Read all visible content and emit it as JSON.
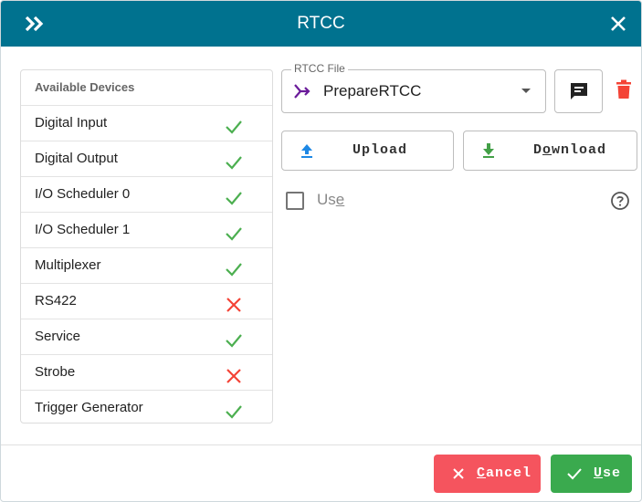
{
  "title": "RTCC",
  "devices": {
    "header": "Available Devices",
    "items": [
      {
        "label": "Digital Input",
        "status": "ok"
      },
      {
        "label": "Digital Output",
        "status": "ok"
      },
      {
        "label": "I/O Scheduler 0",
        "status": "ok"
      },
      {
        "label": "I/O Scheduler 1",
        "status": "ok"
      },
      {
        "label": "Multiplexer",
        "status": "ok"
      },
      {
        "label": "RS422",
        "status": "error"
      },
      {
        "label": "Service",
        "status": "ok"
      },
      {
        "label": "Strobe",
        "status": "error"
      },
      {
        "label": "Trigger Generator",
        "status": "ok"
      }
    ]
  },
  "rtcc_file": {
    "label": "RTCC File",
    "value": "PrepareRTCC"
  },
  "actions": {
    "upload": "Upload",
    "download_pre": "D",
    "download_u": "o",
    "download_post": "wnload"
  },
  "use_option": {
    "pre": "Us",
    "u": "e",
    "checked": false
  },
  "footer": {
    "cancel_u": "C",
    "cancel_rest": "ancel",
    "ok_u": "U",
    "ok_rest": "se"
  },
  "colors": {
    "titlebar": "#00728f",
    "ok": "#4caf50",
    "error": "#f44336",
    "cancel": "#f5545e",
    "confirm": "#3aaa4e",
    "accent": "#1e88e5"
  },
  "icons": {
    "expand": "double-chevron-right-icon",
    "close": "close-icon",
    "rtcc_file": "merge-arrows-icon",
    "comment": "comment-icon",
    "delete": "trash-icon",
    "upload": "upload-icon",
    "download": "download-icon",
    "help": "help-circle-icon",
    "cancel": "x-icon",
    "confirm": "check-icon"
  }
}
